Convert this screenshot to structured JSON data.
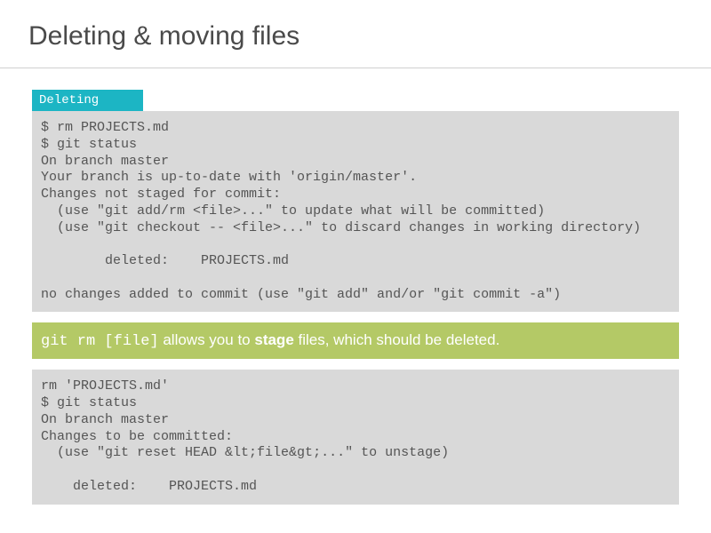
{
  "title": "Deleting & moving files",
  "section_label": "Deleting",
  "code_block_1": "$ rm PROJECTS.md\n$ git status\nOn branch master\nYour branch is up-to-date with 'origin/master'.\nChanges not staged for commit:\n  (use \"git add/rm <file>...\" to update what will be committed)\n  (use \"git checkout -- <file>...\" to discard changes in working directory)\n\n        deleted:    PROJECTS.md\n\nno changes added to commit (use \"git add\" and/or \"git commit -a\")",
  "callout": {
    "code": "git rm [file]",
    "text1": " allows you to ",
    "bold": "stage",
    "text2": " files, which should be deleted."
  },
  "code_block_2": "rm 'PROJECTS.md'\n$ git status\nOn branch master\nChanges to be committed:\n  (use \"git reset HEAD &lt;file&gt;...\" to unstage)\n\n    deleted:    PROJECTS.md"
}
